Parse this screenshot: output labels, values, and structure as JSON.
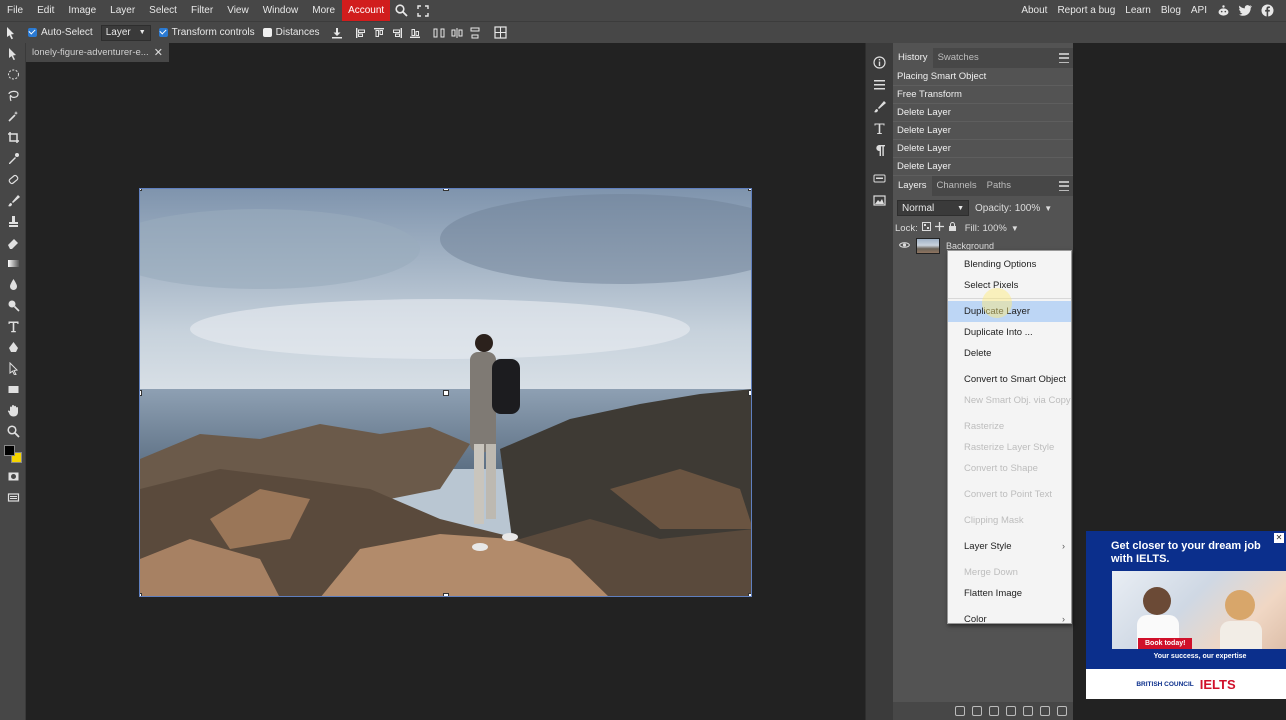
{
  "menubar": {
    "items": [
      "File",
      "Edit",
      "Image",
      "Layer",
      "Select",
      "Filter",
      "View",
      "Window",
      "More"
    ],
    "account": "Account",
    "right_items": [
      "About",
      "Report a bug",
      "Learn",
      "Blog",
      "API"
    ]
  },
  "options": {
    "auto_select_label": "Auto-Select",
    "auto_select_checked": true,
    "target_value": "Layer",
    "transform_controls_label": "Transform controls",
    "transform_controls_checked": true,
    "distances_label": "Distances",
    "distances_checked": false
  },
  "document": {
    "tab_name": "lonely-figure-adventurer-e..."
  },
  "history_panel": {
    "tabs": [
      "History",
      "Swatches"
    ],
    "items": [
      "Placing Smart Object",
      "Free Transform",
      "Delete Layer",
      "Delete Layer",
      "Delete Layer",
      "Delete Layer"
    ]
  },
  "layers_panel": {
    "tabs": [
      "Layers",
      "Channels",
      "Paths"
    ],
    "blend_mode": "Normal",
    "opacity_label": "Opacity:",
    "opacity_value": "100%",
    "lock_label": "Lock:",
    "fill_label": "Fill:",
    "fill_value": "100%",
    "layer_name": "Background"
  },
  "context_menu": {
    "items": [
      {
        "label": "Blending Options",
        "enabled": true
      },
      {
        "label": "Select Pixels",
        "enabled": true
      },
      {
        "label": "Duplicate Layer",
        "enabled": true,
        "highlighted": true
      },
      {
        "label": "Duplicate Into ...",
        "enabled": true
      },
      {
        "label": "Delete",
        "enabled": true
      },
      {
        "label": "Convert to Smart Object",
        "enabled": true
      },
      {
        "label": "New Smart Obj. via Copy",
        "enabled": false
      },
      {
        "label": "Rasterize",
        "enabled": false
      },
      {
        "label": "Rasterize Layer Style",
        "enabled": false
      },
      {
        "label": "Convert to Shape",
        "enabled": false
      },
      {
        "label": "Convert to Point Text",
        "enabled": false
      },
      {
        "label": "Clipping Mask",
        "enabled": false
      },
      {
        "label": "Layer Style",
        "enabled": true,
        "submenu": true
      },
      {
        "label": "Merge Down",
        "enabled": false
      },
      {
        "label": "Flatten Image",
        "enabled": true
      },
      {
        "label": "Color",
        "enabled": true,
        "submenu": true
      }
    ]
  },
  "ad": {
    "headline": "Get closer to your dream job with IELTS.",
    "button": "Book today!",
    "tagline": "Your success, our expertise",
    "brand_left": "BRITISH COUNCIL",
    "brand_right": "IELTS"
  },
  "colors": {
    "account_red": "#d11d1d",
    "selection_blue": "#bdd6f5",
    "foreground": "#000000",
    "background": "#f5d400"
  }
}
